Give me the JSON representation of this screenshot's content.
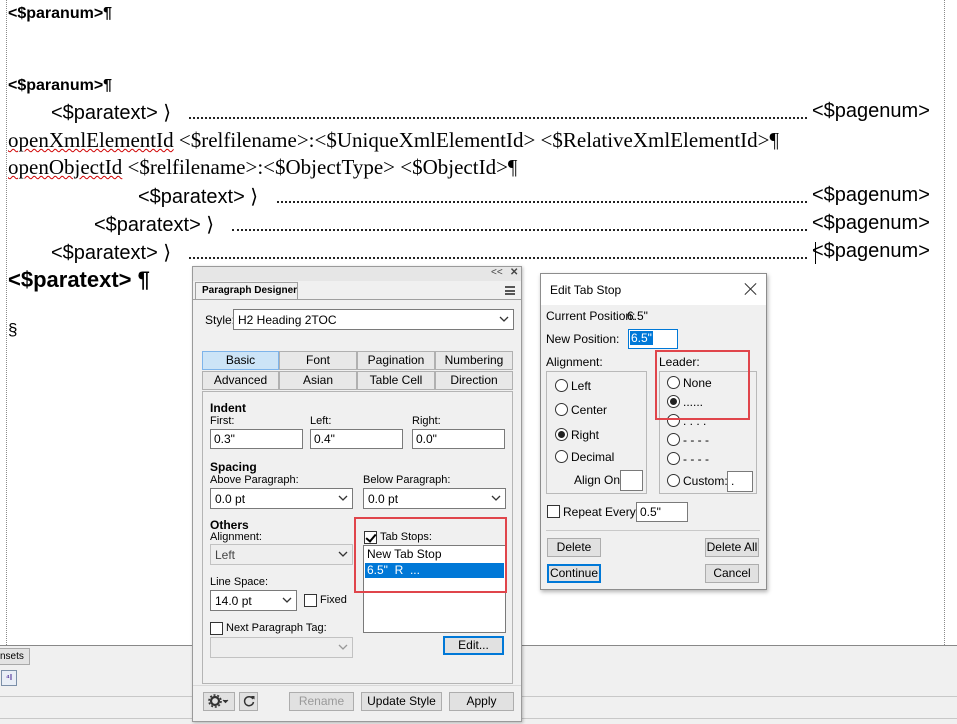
{
  "document": {
    "line1": "<$paranum>¶",
    "line2": "<$paranum>¶",
    "toc_rows": [
      {
        "text": "<$paratext> ⟩",
        "pagenum": "<$pagenum>"
      },
      {
        "text": "<$paratext> ⟩",
        "pagenum": "<$pagenum>"
      },
      {
        "text": "<$paratext> ⟩",
        "pagenum": "<$pagenum>"
      },
      {
        "text": "<$paratext> ⟩",
        "pagenum": "<$pagenum>"
      }
    ],
    "xml_line_prefix": "openXmlElementId",
    "xml_line_rest": " <$relfilename>:<$UniqueXmlElementId> <$RelativeXmlElementId>¶",
    "obj_line_prefix": "openObjectId",
    "obj_line_rest": " <$relfilename>:<$ObjectType> <$ObjectId>¶",
    "heading": "<$paratext> ¶",
    "section_mark": "§"
  },
  "bottom_panel": {
    "tab_label": "nsets",
    "icon_text": "⁴I"
  },
  "paragraph_designer": {
    "title": "Paragraph Designer",
    "top_glyphs": {
      "collapse": "<<",
      "close": "✕"
    },
    "style_label": "Style:",
    "style_value": "H2 Heading 2TOC",
    "tabs_row1": [
      "Basic",
      "Font",
      "Pagination",
      "Numbering"
    ],
    "tabs_row2": [
      "Advanced",
      "Asian",
      "Table Cell",
      "Direction"
    ],
    "active_tab": "Basic",
    "indent": {
      "header": "Indent",
      "first_label": "First:",
      "first_value": "0.3\"",
      "left_label": "Left:",
      "left_value": "0.4\"",
      "right_label": "Right:",
      "right_value": "0.0\""
    },
    "spacing": {
      "header": "Spacing",
      "above_label": "Above Paragraph:",
      "above_value": "0.0 pt",
      "below_label": "Below Paragraph:",
      "below_value": "0.0 pt"
    },
    "others": {
      "header": "Others",
      "alignment_label": "Alignment:",
      "alignment_value": "Left",
      "line_space_label": "Line Space:",
      "line_space_value": "14.0 pt",
      "fixed_label": "Fixed",
      "fixed_checked": false,
      "next_tag_label": "Next Paragraph Tag:",
      "next_tag_checked": false,
      "next_tag_value": ""
    },
    "tab_stops": {
      "label": "Tab Stops:",
      "checked": true,
      "items": [
        "New Tab Stop",
        "6.5\"  R  ..."
      ],
      "selected_index": 1,
      "edit_button": "Edit..."
    },
    "footer": {
      "rename": "Rename",
      "update_style": "Update Style",
      "apply": "Apply"
    }
  },
  "edit_tab_stop": {
    "title": "Edit Tab Stop",
    "current_position_label": "Current Position:",
    "current_position_value": "6.5\"",
    "new_position_label": "New Position:",
    "new_position_value": "6.5\"",
    "alignment": {
      "label": "Alignment:",
      "options": [
        "Left",
        "Center",
        "Right",
        "Decimal"
      ],
      "selected": "Right",
      "align_on_label": "Align On:",
      "align_on_value": ""
    },
    "leader": {
      "label": "Leader:",
      "options": [
        "None",
        "......",
        ". . . .",
        "- - - -",
        "- -  -  -",
        "Custom:"
      ],
      "selected_index": 1,
      "custom_value": "."
    },
    "repeat_every_label": "Repeat Every:",
    "repeat_every_checked": false,
    "repeat_every_value": "0.5\"",
    "buttons": {
      "delete": "Delete",
      "delete_all": "Delete All",
      "continue": "Continue",
      "cancel": "Cancel"
    }
  },
  "colors": {
    "highlight_box": "#e0454b",
    "selection_blue": "#0078d7",
    "active_tab": "#cce4f7",
    "spellcheck_squiggle": "#d00000"
  }
}
